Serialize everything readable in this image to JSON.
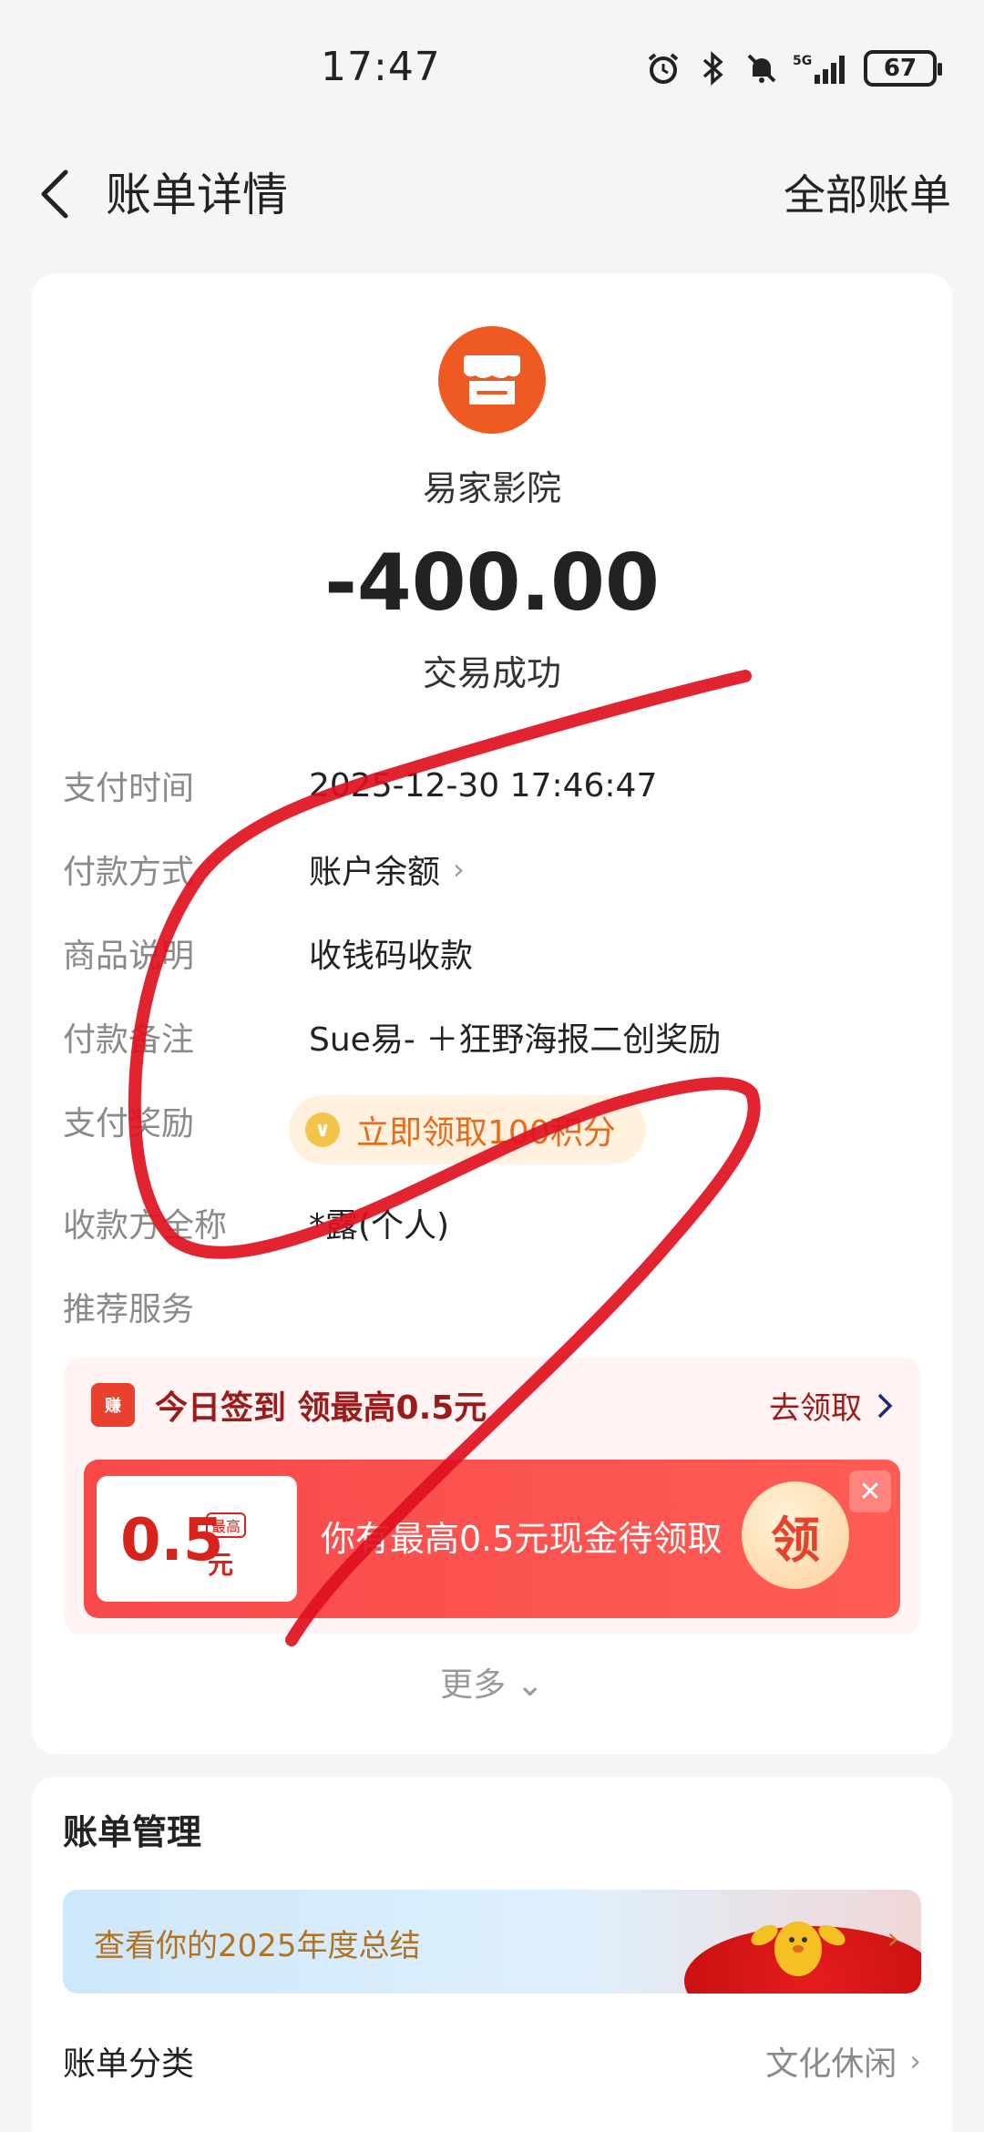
{
  "status_bar": {
    "time": "17:47",
    "battery": "67",
    "network": "5G"
  },
  "nav": {
    "title": "账单详情",
    "right": "全部账单"
  },
  "bill": {
    "merchant": "易家影院",
    "amount": "-400.00",
    "status": "交易成功",
    "rows": [
      {
        "label": "支付时间",
        "value": "2025-12-30 17:46:47"
      },
      {
        "label": "付款方式",
        "value": "账户余额"
      },
      {
        "label": "商品说明",
        "value": "收钱码收款"
      },
      {
        "label": "付款备注",
        "value": "Sue易- ＋狂野海报二创奖励"
      },
      {
        "label": "支付奖励",
        "value": ""
      },
      {
        "label": "收款方全称",
        "value": "*露(个人)"
      },
      {
        "label": "推荐服务",
        "value": ""
      }
    ],
    "reward_text": "立即领取100积分",
    "more": "更多"
  },
  "promo": {
    "title": "今日签到 领最高0.5元",
    "action": "去领取",
    "coupon_value": "0.5",
    "coupon_unit": "元",
    "coupon_tag": "最高",
    "banner_text": "你有最高0.5元现金待领取",
    "grab": "领",
    "cal_text": "赚"
  },
  "management": {
    "title": "账单管理",
    "summary": "查看你的2025年度总结",
    "category_label": "账单分类",
    "category_value": "文化休闲"
  },
  "colors": {
    "accent_orange": "#ee5a21",
    "promo_red": "#f7494a",
    "scribble": "#e0101e"
  }
}
